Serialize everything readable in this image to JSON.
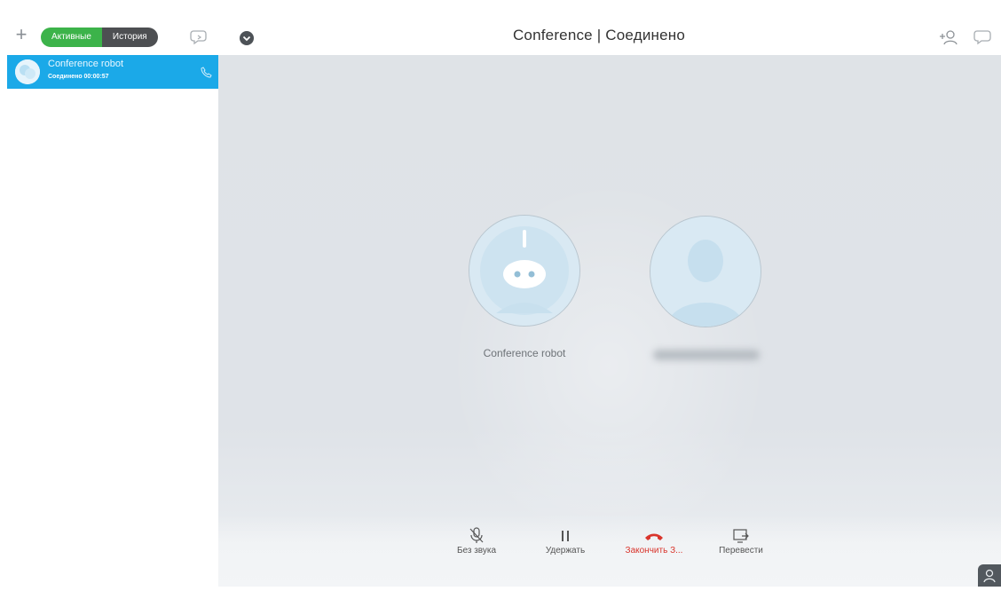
{
  "tabs": {
    "active_label": "Активные",
    "history_label": "История"
  },
  "header": {
    "title": "Conference | Соединено"
  },
  "sidebar": {
    "calls": [
      {
        "name": "Conference robot",
        "status": "Соединено 00:00:57"
      }
    ]
  },
  "stage": {
    "participants": [
      {
        "name": "Conference robot",
        "avatar": "robot-icon"
      },
      {
        "name": "",
        "avatar": "person-icon"
      }
    ]
  },
  "controls": {
    "mute_label": "Без звука",
    "hold_label": "Удержать",
    "end_label": "Закончить З...",
    "transfer_label": "Перевести"
  },
  "colors": {
    "accent_green": "#3cb34a",
    "accent_blue": "#1ba9e8",
    "end_red": "#d9342b",
    "tab_dark": "#4d4f52"
  },
  "icons": {
    "new": "plus-icon",
    "chat": "chat-bubble-icon",
    "collapse": "chevron-down-icon",
    "add_user": "add-user-icon",
    "mute": "mic-off-icon",
    "hold": "pause-icon",
    "end": "hang-up-icon",
    "transfer": "transfer-icon"
  }
}
